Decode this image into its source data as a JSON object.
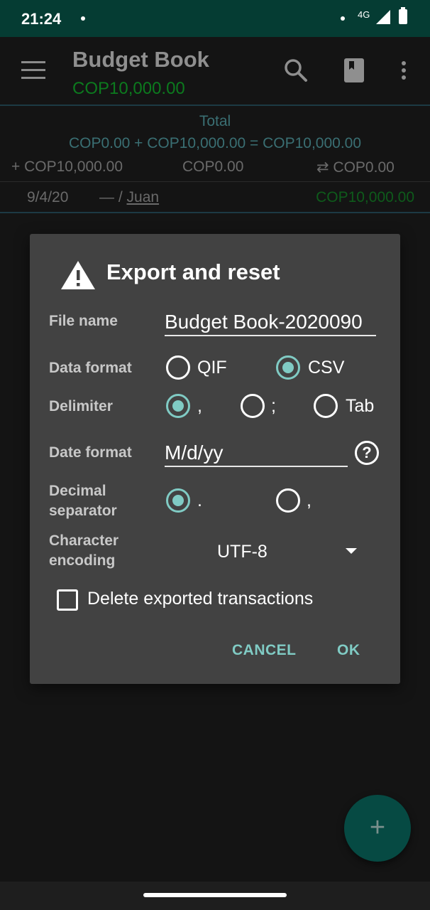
{
  "status_bar": {
    "time": "21:24",
    "network": "4G"
  },
  "app_bar": {
    "title": "Budget Book",
    "subtitle": "COP10,000.00"
  },
  "summary": {
    "label": "Total",
    "formula": "COP0.00 + COP10,000.00 = COP10,000.00",
    "income": "+ COP10,000.00",
    "expense": "COP0.00",
    "transfer": "⇄ COP0.00"
  },
  "transaction": {
    "date": "9/4/20",
    "category": "— / ",
    "payee": "Juan",
    "amount": "COP10,000.00"
  },
  "dialog": {
    "title": "Export and reset",
    "file_name_label": "File name",
    "file_name_value": "Budget Book-2020090",
    "data_format_label": "Data format",
    "data_format_options": [
      "QIF",
      "CSV"
    ],
    "data_format_selected": "CSV",
    "delimiter_label": "Delimiter",
    "delimiter_options": [
      ",",
      ";",
      "Tab"
    ],
    "delimiter_selected": ",",
    "date_format_label": "Date format",
    "date_format_value": "M/d/yy",
    "decimal_label_line1": "Decimal",
    "decimal_label_line2": "separator",
    "decimal_options": [
      ".",
      ","
    ],
    "decimal_selected": ".",
    "encoding_label_line1": "Character",
    "encoding_label_line2": "encoding",
    "encoding_value": "UTF-8",
    "delete_label": "Delete exported transactions",
    "delete_checked": false,
    "cancel_label": "CANCEL",
    "ok_label": "OK"
  },
  "fab": {
    "label": "+"
  },
  "colors": {
    "accent": "#80cbc4",
    "status_bar": "#053c33",
    "dialog_bg": "#424242",
    "positive": "#0c7a1e"
  }
}
